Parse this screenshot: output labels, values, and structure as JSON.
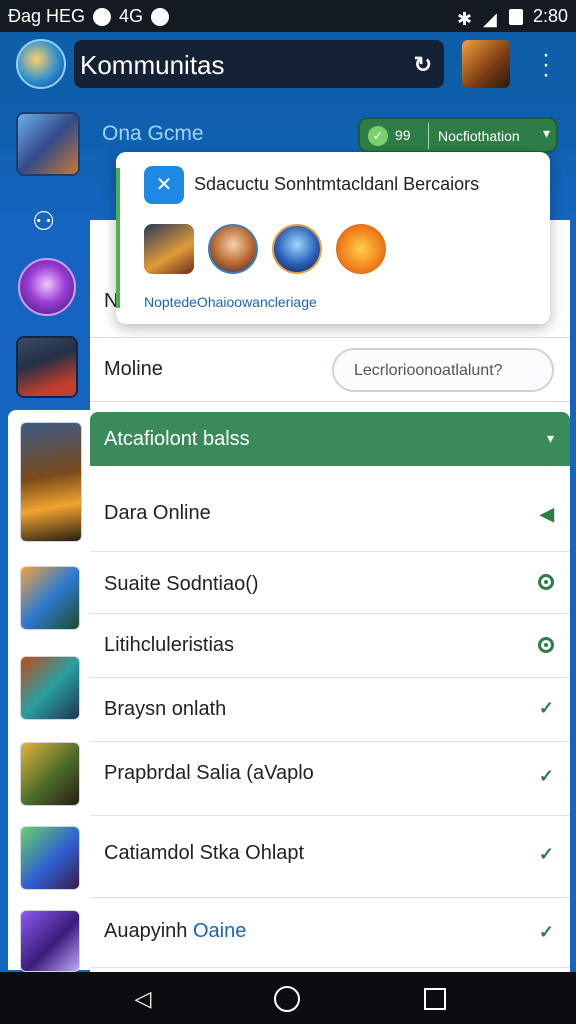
{
  "status_bar": {
    "left_text": "Đag HEG",
    "network": "4G",
    "time": "2:80"
  },
  "header": {
    "title": "Kommunitas"
  },
  "game": {
    "name": "Ona Gcme"
  },
  "notification": {
    "count": "99",
    "label": "Nocfiothation"
  },
  "popover": {
    "title": "Sdacuctu Sonhtmtacldanl Bercaiors",
    "link": "NoptedeOhaioowancleriage"
  },
  "rows": {
    "n_letter": "N",
    "online_label": "Moline",
    "search_placeholder": "Lecrlorioonoatlalunt?"
  },
  "section": {
    "title": "Atcafiolont balss"
  },
  "list": [
    {
      "label": "Dara Online",
      "status": "sent-icon"
    },
    {
      "label": "Suaite Sodntiao()",
      "status": "radio-on-icon"
    },
    {
      "label": "Litihcluleristias",
      "status": "radio-on-icon"
    },
    {
      "label": "Braysn onlath",
      "status": "check-icon"
    },
    {
      "label": "Prapbrdal Salia (aVaplo",
      "status": "check-icon"
    },
    {
      "label": "Catiamdol Stka Ohlapt",
      "status": "check-icon"
    },
    {
      "label_a": "Auapyinh ",
      "label_b": "Oaine",
      "status": "check-icon"
    }
  ],
  "colors": {
    "accent_green": "#3b8a5a",
    "header_blue": "#0e5eaa",
    "link_blue": "#1565c0"
  }
}
